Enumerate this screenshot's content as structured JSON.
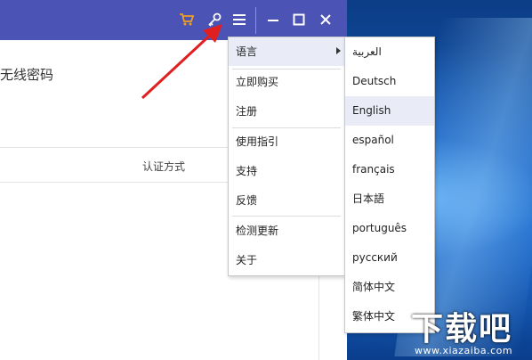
{
  "titlebar": {
    "icons": [
      "cart-icon",
      "key-icon",
      "menu-icon",
      "minimize-icon",
      "maximize-icon",
      "close-icon"
    ],
    "accent_color": "#4b53b4",
    "cart_color": "#f0a020"
  },
  "main": {
    "wifi_password_title": "无线密码",
    "column_header": "认证方式"
  },
  "menu": {
    "items": [
      {
        "label": "语言"
      },
      {
        "label": "立即购买"
      },
      {
        "label": "注册"
      },
      {
        "label": "使用指引"
      },
      {
        "label": "支持"
      },
      {
        "label": "反馈"
      },
      {
        "label": "检测更新"
      },
      {
        "label": "关于"
      }
    ]
  },
  "language_menu": {
    "items": [
      {
        "label": "العربية"
      },
      {
        "label": "Deutsch"
      },
      {
        "label": "English"
      },
      {
        "label": "español"
      },
      {
        "label": "français"
      },
      {
        "label": "日本語"
      },
      {
        "label": "português"
      },
      {
        "label": "русский"
      },
      {
        "label": "简体中文"
      },
      {
        "label": "繁体中文"
      }
    ],
    "selected": "English"
  },
  "watermark": {
    "brand": "下载吧",
    "url": "www.xiazaiba.com"
  }
}
